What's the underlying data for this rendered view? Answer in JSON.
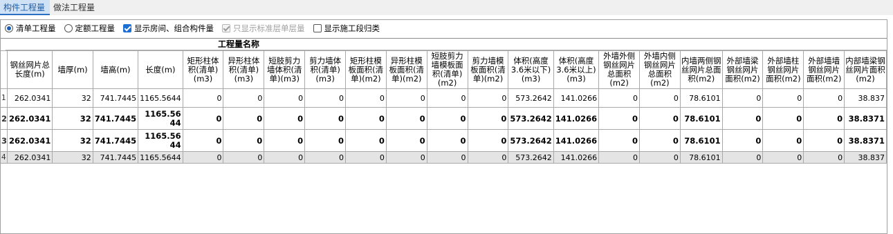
{
  "tabs": [
    {
      "label": "构件工程量",
      "active": true
    },
    {
      "label": "做法工程量",
      "active": false
    }
  ],
  "options": {
    "radio_list": "清单工程量",
    "radio_quota": "定额工程量",
    "show_rooms": "显示房间、组合构件量",
    "show_std_floor": "只显示标准层单层量",
    "show_stage": "显示施工段归类"
  },
  "grid": {
    "group_title": "工程量名称",
    "columns": [
      "钢丝网片总长度(m)",
      "墙厚(m)",
      "墙高(m)",
      "长度(m)",
      "矩形柱体积(清单)(m3)",
      "异形柱体积(清单)(m3)",
      "短肢剪力墙体积(清单)(m3)",
      "剪力墙体积(清单)(m3)",
      "矩形柱模板面积(清单)(m2)",
      "异形柱模板面积(清单)(m2)",
      "短肢剪力墙模板面积(清单)(m2)",
      "剪力墙模板面积(清单)(m2)",
      "体积(高度3.6米以下)(m3)",
      "体积(高度3.6米以上)(m3)",
      "外墙外侧钢丝网片总面积(m2)",
      "外墙内侧钢丝网片总面积(m2)",
      "内墙两侧钢丝网片总面积(m2)",
      "外部墙梁钢丝网片面积(m2)",
      "外部墙柱钢丝网片面积(m2)",
      "外部墙墙钢丝网片面积(m2)",
      "内部墙梁钢丝网片面积(m2)"
    ],
    "rows": [
      {
        "num": "1",
        "cells": [
          "262.0341",
          "32",
          "741.7445",
          "1165.5644",
          "0",
          "0",
          "0",
          "0",
          "0",
          "0",
          "0",
          "0",
          "573.2642",
          "141.0266",
          "0",
          "0",
          "78.6101",
          "0",
          "0",
          "0",
          "38.837"
        ]
      },
      {
        "num": "2",
        "cells": [
          "262.0341",
          "32",
          "741.7445",
          "1165.5644",
          "0",
          "0",
          "0",
          "0",
          "0",
          "0",
          "0",
          "0",
          "573.2642",
          "141.0266",
          "0",
          "0",
          "78.6101",
          "0",
          "0",
          "0",
          "38.8371"
        ]
      },
      {
        "num": "3",
        "cells": [
          "262.0341",
          "32",
          "741.7445",
          "1165.5644",
          "0",
          "0",
          "0",
          "0",
          "0",
          "0",
          "0",
          "0",
          "573.2642",
          "141.0266",
          "0",
          "0",
          "78.6101",
          "0",
          "0",
          "0",
          "38.8371"
        ]
      },
      {
        "num": "4",
        "cells": [
          "262.0341",
          "32",
          "741.7445",
          "1165.5644",
          "0",
          "0",
          "0",
          "0",
          "0",
          "0",
          "0",
          "0",
          "573.2642",
          "141.0266",
          "0",
          "0",
          "78.6101",
          "0",
          "0",
          "0",
          "38.837"
        ]
      }
    ]
  }
}
